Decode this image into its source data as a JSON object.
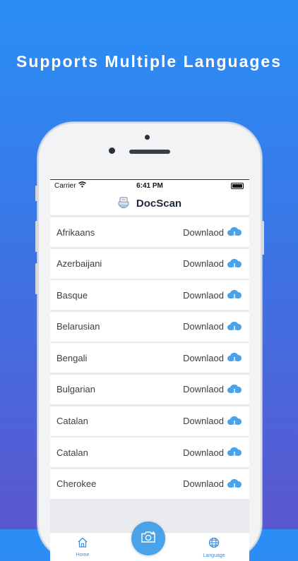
{
  "headline": "Supports Multiple Languages",
  "status_bar": {
    "carrier": "Carrier",
    "time": "6:41 PM"
  },
  "navbar": {
    "title": "DocScan",
    "logo_icon": "document-icon"
  },
  "languages": [
    {
      "name": "Afrikaans",
      "action": "Downlaod"
    },
    {
      "name": "Azerbaijani",
      "action": "Downlaod"
    },
    {
      "name": "Basque",
      "action": "Downlaod"
    },
    {
      "name": "Belarusian",
      "action": "Downlaod"
    },
    {
      "name": "Bengali",
      "action": "Downlaod"
    },
    {
      "name": "Bulgarian",
      "action": "Downlaod"
    },
    {
      "name": "Catalan",
      "action": "Downlaod"
    },
    {
      "name": "Catalan",
      "action": "Downlaod"
    },
    {
      "name": "Cherokee",
      "action": "Downlaod"
    }
  ],
  "tabbar": {
    "home_label": "Home",
    "language_label": "Language",
    "camera_icon": "camera-icon"
  },
  "colors": {
    "accent": "#4aa3e8",
    "background_top": "#2a8ff5",
    "background_bottom": "#5a57cf"
  }
}
